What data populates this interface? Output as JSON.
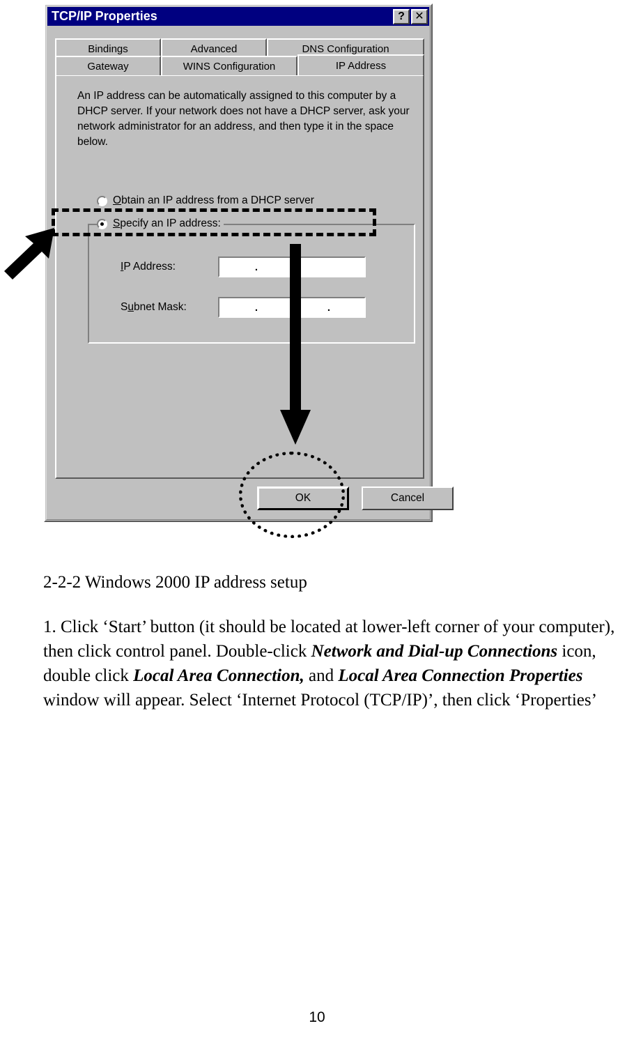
{
  "dialog": {
    "title": "TCP/IP Properties",
    "titlebar_buttons": [
      {
        "name": "help-button",
        "glyph": "?"
      },
      {
        "name": "close-button",
        "glyph": "✕"
      }
    ],
    "tabs_row1": [
      {
        "label": "Bindings",
        "selected": false
      },
      {
        "label": "Advanced",
        "selected": false
      },
      {
        "label": "DNS Configuration",
        "selected": false
      }
    ],
    "tabs_row2": [
      {
        "label": "Gateway",
        "selected": false
      },
      {
        "label": "WINS Configuration",
        "selected": false
      },
      {
        "label": "IP Address",
        "selected": true
      }
    ],
    "description": "An IP address can be automatically assigned to this computer by a DHCP server. If your network does not have a DHCP server, ask your network administrator for an address, and then type it in the space below.",
    "radio_dhcp": {
      "label": "Obtain an IP address from a DHCP server",
      "selected": false
    },
    "radio_specify": {
      "label": "Specify an IP address:",
      "selected": true
    },
    "fields": [
      {
        "label": "IP Address:",
        "value": "",
        "octets": [
          "",
          "",
          "",
          ""
        ]
      },
      {
        "label": "Subnet Mask:",
        "value": "",
        "octets": [
          "",
          "",
          "",
          ""
        ]
      }
    ],
    "buttons": {
      "ok": "OK",
      "cancel": "Cancel"
    },
    "colors": {
      "titlebar": "#000080",
      "face": "#c0c0c0",
      "shadow": "#808080",
      "highlight": "#ffffff",
      "text": "#000000"
    }
  },
  "annotations": {
    "dashed_rect_target": "Specify an IP address:",
    "dashed_ellipse_target": "OK",
    "left_arrow": "pointer-arrow",
    "down_arrow": "flow-arrow"
  },
  "document": {
    "heading": "2-2-2 Windows 2000 IP address setup",
    "paragraph": {
      "segments": [
        {
          "text": "1. Click ‘Start’ button (it should be located at lower-left corner of your computer), then click control panel. Double-click ",
          "bold": false
        },
        {
          "text": "Network and Dial-up Connections",
          "bold": true
        },
        {
          "text": " icon, double click ",
          "bold": false
        },
        {
          "text": "Local Area Connection,",
          "bold": true
        },
        {
          "text": " and ",
          "bold": false
        },
        {
          "text": "Local Area Connection Properties",
          "bold": true
        },
        {
          "text": " window will appear. Select ‘Internet Protocol (TCP/IP)’, then click ‘Properties’",
          "bold": false
        }
      ]
    },
    "page_number": "10"
  }
}
